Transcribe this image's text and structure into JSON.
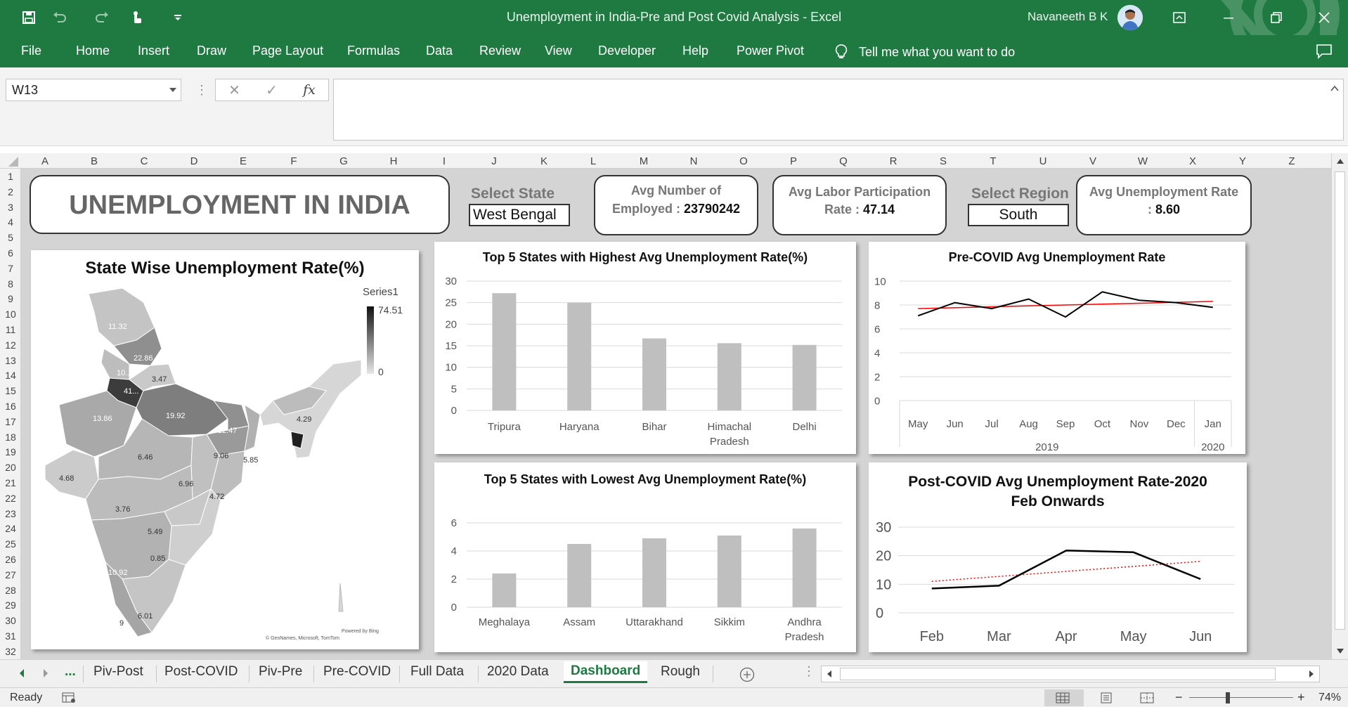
{
  "window": {
    "title": "Unemployment in India-Pre and Post Covid Analysis  -  Excel",
    "user": "Navaneeth B K"
  },
  "icons": [
    "save-icon",
    "undo-icon",
    "redo-icon",
    "touch-mode-icon",
    "customize-qat-icon",
    "ribbon-display-icon",
    "minimize-icon",
    "restore-icon",
    "close-icon",
    "lightbulb-icon",
    "comments-icon"
  ],
  "ribbon": {
    "tabs": [
      "File",
      "Home",
      "Insert",
      "Draw",
      "Page Layout",
      "Formulas",
      "Data",
      "Review",
      "View",
      "Developer",
      "Help",
      "Power Pivot"
    ],
    "tell_me": "Tell me what you want to do"
  },
  "formula_bar": {
    "name_box": "W13",
    "cancel": "✕",
    "enter": "✓",
    "fx": "fx",
    "content": ""
  },
  "columns": [
    "A",
    "B",
    "C",
    "D",
    "E",
    "F",
    "G",
    "H",
    "I",
    "J",
    "K",
    "L",
    "M",
    "N",
    "O",
    "P",
    "Q",
    "R",
    "S",
    "T",
    "U",
    "V",
    "W",
    "X",
    "Y",
    "Z"
  ],
  "rows": [
    "1",
    "2",
    "3",
    "4",
    "5",
    "6",
    "7",
    "8",
    "9",
    "10",
    "11",
    "12",
    "13",
    "14",
    "15",
    "16",
    "17",
    "18",
    "19",
    "20",
    "21",
    "22",
    "23",
    "24",
    "25",
    "26",
    "27",
    "28",
    "29",
    "30",
    "31",
    "32"
  ],
  "dashboard": {
    "title": "UNEMPLOYMENT IN INDIA",
    "select_state_label": "Select State",
    "select_state_value": "West Bengal",
    "kpi_employed_label_1": "Avg Number of",
    "kpi_employed_label_2": "Employed :",
    "kpi_employed_value": "23790242",
    "kpi_labor_label_1": "Avg Labor Participation",
    "kpi_labor_label_2": "Rate :",
    "kpi_labor_value": "47.14",
    "select_region_label": "Select Region",
    "select_region_value": "South",
    "kpi_unemp_label_1": "Avg Unemployment Rate",
    "kpi_unemp_label_2": ":",
    "kpi_unemp_value": "8.60"
  },
  "map": {
    "title": "State Wise Unemployment Rate(%)",
    "legend_title": "Series1",
    "legend_max": "74.51",
    "legend_min": "0",
    "labels": [
      "11.32",
      "22.86",
      "10...",
      "3.47",
      "41...",
      "13.86",
      "19.92",
      "12.47",
      "4.29",
      "4.68",
      "6.46",
      "9.06",
      "5.85",
      "6.96",
      "4.72",
      "3.76",
      "5.49",
      "0.85",
      "10.92",
      "6.01",
      "9"
    ],
    "credit_1": "Powered by Bing",
    "credit_2": "© GeoNames, Microsoft, TomTom"
  },
  "chart_data": [
    {
      "type": "bar",
      "title": "Top 5 States with Highest Avg Unemployment  Rate(%)",
      "categories": [
        "Tripura",
        "Haryana",
        "Bihar",
        "Himachal Pradesh",
        "Delhi"
      ],
      "values": [
        27.2,
        25.0,
        16.7,
        15.6,
        15.2
      ],
      "ylim": [
        0,
        30
      ],
      "yticks": [
        "0",
        "5",
        "10",
        "15",
        "20",
        "25",
        "30"
      ],
      "grid": true,
      "color": "#bfbfbf"
    },
    {
      "type": "bar",
      "title": "Top 5 States with Lowest Avg Unemployment Rate(%)",
      "categories": [
        "Meghalaya",
        "Assam",
        "Uttarakhand",
        "Sikkim",
        "Andhra Pradesh"
      ],
      "values": [
        2.4,
        4.5,
        4.9,
        5.1,
        5.6
      ],
      "ylim": [
        0,
        6
      ],
      "yticks": [
        "0",
        "2",
        "4",
        "6"
      ],
      "grid": true,
      "color": "#bfbfbf"
    },
    {
      "type": "line",
      "title": "Pre-COVID Avg Unemployment Rate",
      "categories": [
        "May",
        "Jun",
        "Jul",
        "Aug",
        "Sep",
        "Oct",
        "Nov",
        "Dec",
        "Jan"
      ],
      "year_groups": [
        "2019",
        "2020"
      ],
      "series": [
        {
          "values": [
            7.1,
            8.2,
            7.7,
            8.5,
            7.0,
            9.1,
            8.4,
            8.2,
            7.8
          ],
          "color": "#000000"
        }
      ],
      "trendline": {
        "start": 7.7,
        "end": 8.3,
        "color": "#ff0000"
      },
      "ylim": [
        0,
        10
      ],
      "yticks": [
        "0",
        "2",
        "4",
        "6",
        "8",
        "10"
      ],
      "grid": true
    },
    {
      "type": "line",
      "title": "Post-COVID Avg Unemployment Rate-2020 Feb Onwards",
      "title_line_1": "Post-COVID Avg Unemployment Rate-2020",
      "title_line_2": "Feb Onwards",
      "categories": [
        "Feb",
        "Mar",
        "Apr",
        "May",
        "Jun"
      ],
      "series": [
        {
          "values": [
            8.5,
            9.5,
            21.8,
            21.2,
            11.8
          ],
          "color": "#000000"
        }
      ],
      "trendline": {
        "start": 11.0,
        "end": 18.0,
        "color": "#ff0000",
        "style": "dotted"
      },
      "ylim": [
        0,
        30
      ],
      "yticks": [
        "0",
        "10",
        "20",
        "30"
      ],
      "grid": true
    }
  ],
  "sheet_tabs": {
    "nav_more": "...",
    "tabs": [
      "Piv-Post",
      "Post-COVID",
      "Piv-Pre",
      "Pre-COVID",
      "Full Data",
      "2020 Data",
      "Dashboard",
      "Rough"
    ],
    "active": "Dashboard"
  },
  "status": {
    "mode": "Ready",
    "zoom": "74%",
    "minus": "−",
    "plus": "+"
  }
}
